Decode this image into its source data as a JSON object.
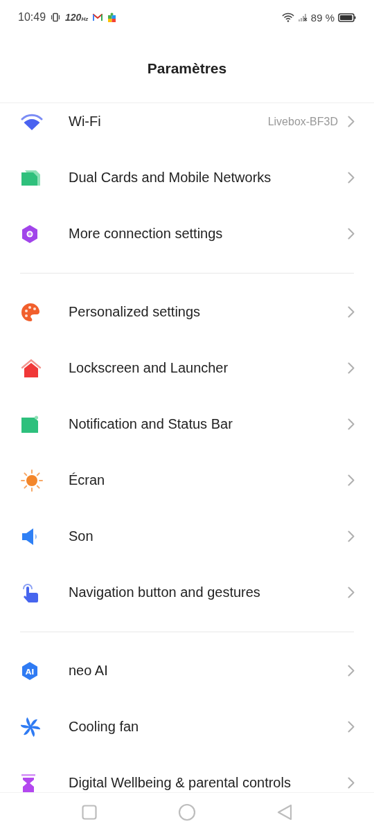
{
  "status_bar": {
    "time": "10:49",
    "refresh_rate": "120",
    "refresh_unit": "Hz",
    "battery": "89 %"
  },
  "header": {
    "title": "Paramètres"
  },
  "groups": [
    {
      "items": [
        {
          "kind": "wifi",
          "label": "Wi-Fi",
          "value": "Livebox-BF3D"
        },
        {
          "kind": "sim",
          "label": "Dual Cards and Mobile Networks"
        },
        {
          "kind": "hexagon",
          "label": "More connection settings"
        }
      ]
    },
    {
      "items": [
        {
          "kind": "palette",
          "label": "Personalized settings"
        },
        {
          "kind": "home",
          "label": "Lockscreen and Launcher"
        },
        {
          "kind": "notification",
          "label": "Notification and Status Bar"
        },
        {
          "kind": "sun",
          "label": "Écran"
        },
        {
          "kind": "speaker",
          "label": "Son"
        },
        {
          "kind": "hand",
          "label": "Navigation button and gestures"
        }
      ]
    },
    {
      "items": [
        {
          "kind": "ai",
          "badge": "AI",
          "label": "neo AI"
        },
        {
          "kind": "fan",
          "label": "Cooling fan"
        },
        {
          "kind": "hourglass",
          "label": "Digital Wellbeing & parental controls"
        }
      ]
    }
  ]
}
